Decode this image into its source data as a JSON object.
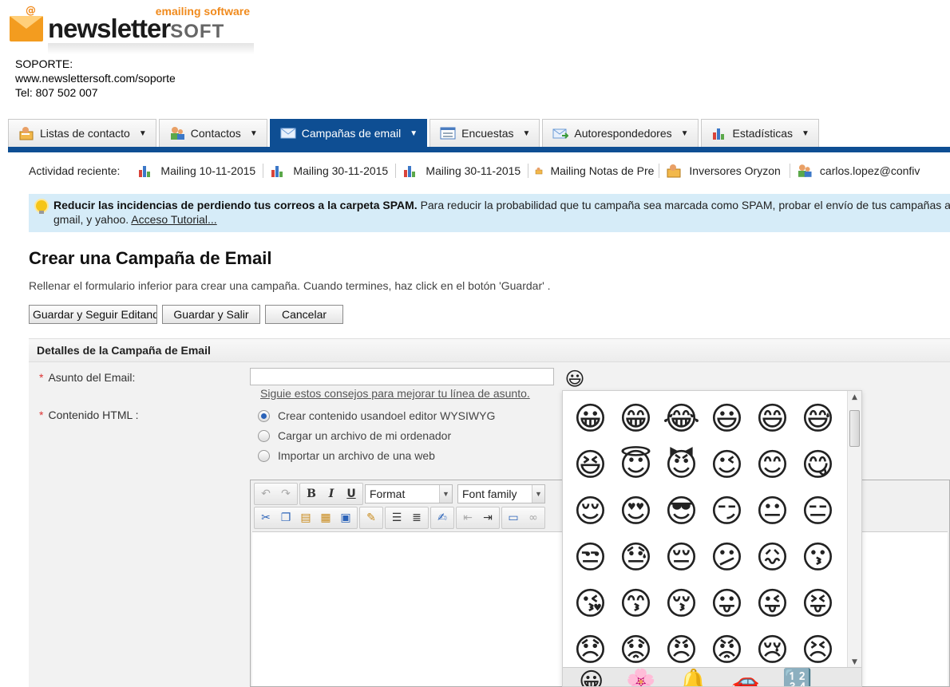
{
  "brand": {
    "tagline": "emailing software",
    "name": "newsletter",
    "suffix": "SOFT"
  },
  "support": {
    "label": "SOPORTE:",
    "url": "www.newslettersoft.com/soporte",
    "phone": "Tel: 807 502 007"
  },
  "tabs": [
    {
      "label": "Listas de contacto",
      "icon": "contact-list-icon"
    },
    {
      "label": "Contactos",
      "icon": "contacts-icon"
    },
    {
      "label": "Campañas de email",
      "icon": "envelope-icon",
      "active": true
    },
    {
      "label": "Encuestas",
      "icon": "survey-icon"
    },
    {
      "label": "Autorespondedores",
      "icon": "autoresponder-icon"
    },
    {
      "label": "Estadísticas",
      "icon": "stats-icon"
    }
  ],
  "recent": {
    "label": "Actividad reciente:",
    "items": [
      {
        "label": "Mailing 10-11-2015",
        "icon": "chart-icon"
      },
      {
        "label": "Mailing 30-11-2015",
        "icon": "chart-icon"
      },
      {
        "label": "Mailing 30-11-2015",
        "icon": "chart-icon"
      },
      {
        "label": "Mailing Notas de Pre",
        "icon": "list-icon"
      },
      {
        "label": "Inversores Oryzon",
        "icon": "list-icon"
      },
      {
        "label": "carlos.lopez@confiv",
        "icon": "contact-icon"
      }
    ]
  },
  "tip": {
    "bold": "Reducir las incidencias de perdiendo tus correos a la carpeta SPAM.",
    "text": "Para reducir la probabilidad que tu campaña sea marcada como SPAM, probar el envío de tus campañas a to",
    "text2": "gmail, y yahoo.",
    "link": "Acceso Tutorial..."
  },
  "page": {
    "title": "Crear una Campaña de Email",
    "intro": "Rellenar el formulario inferior para crear una campaña. Cuando termines, haz click en el botón 'Guardar' ."
  },
  "buttons": {
    "save_continue": "Guardar y Seguir Editando",
    "save_exit": "Guardar y Salir",
    "cancel": "Cancelar"
  },
  "section": {
    "title": "Detalles de la Campaña de Email"
  },
  "form": {
    "subject_label": "Asunto del Email:",
    "subject_value": "",
    "subject_tip": "Siguie estos consejos para mejorar tu línea de asunto.",
    "html_label": "Contenido HTML :",
    "options": [
      {
        "label": "Crear contenido usandoel editor WYSIWYG",
        "selected": true
      },
      {
        "label": "Cargar un archivo de mi ordenador",
        "selected": false
      },
      {
        "label": "Importar un archivo de una web",
        "selected": false
      }
    ]
  },
  "editor": {
    "format_label": "Format",
    "font_label": "Font family"
  },
  "emoji": {
    "trigger": "😃",
    "grid": [
      "😀",
      "😁",
      "😂",
      "😃",
      "😄",
      "😅",
      "😆",
      "😇",
      "😈",
      "😉",
      "😊",
      "😋",
      "😌",
      "😍",
      "😎",
      "😏",
      "😐",
      "😑",
      "😒",
      "😓",
      "😔",
      "😕",
      "😖",
      "😗",
      "😘",
      "😙",
      "😚",
      "😛",
      "😜",
      "😝",
      "😞",
      "😟",
      "😠",
      "😡",
      "😢",
      "😣"
    ],
    "categories": [
      "😀",
      "🌸",
      "🔔",
      "🚗",
      "🔢"
    ]
  }
}
